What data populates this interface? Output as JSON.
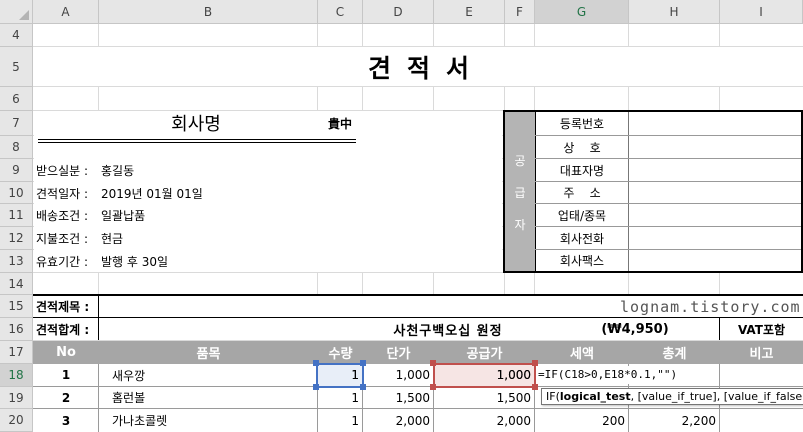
{
  "columns": [
    "A",
    "B",
    "C",
    "D",
    "E",
    "F",
    "G",
    "H",
    "I"
  ],
  "rows": [
    "4",
    "5",
    "6",
    "7",
    "8",
    "9",
    "10",
    "11",
    "12",
    "13",
    "14",
    "15",
    "16",
    "17",
    "18",
    "19",
    "20"
  ],
  "document_title": "견적서",
  "company_label": "회사명",
  "honorific": "貴中",
  "info_rows": [
    {
      "label": "받으실분 :",
      "value": "홍길동"
    },
    {
      "label": "견적일자 :",
      "value": "2019년 01월 01일"
    },
    {
      "label": "배송조건 :",
      "value": "일괄납품"
    },
    {
      "label": "지불조건 :",
      "value": "현금"
    },
    {
      "label": "유효기간 :",
      "value": "발행 후 30일"
    }
  ],
  "supplier": {
    "tag_chars": [
      "공",
      "급",
      "자"
    ],
    "fields": [
      "등록번호",
      "상    호",
      "대표자명",
      "주    소",
      "업태/종목",
      "회사전화",
      "회사팩스"
    ]
  },
  "quote_subject_label": "견적제목 :",
  "quote_total_label": "견적합계 :",
  "quote_total_words": "사천구백오십 원정",
  "quote_total_amount": "(₩4,950)",
  "vat_note": "VAT포함",
  "watermark": "lognam.tistory.com",
  "table_headers": [
    "No",
    "품목",
    "수량",
    "단가",
    "공급가",
    "세액",
    "총계",
    "비고"
  ],
  "table_rows": [
    {
      "no": "1",
      "item": "새우깡",
      "qty": "1",
      "price": "1,000",
      "supply": "1,000",
      "tax": "",
      "total": "",
      "note": ""
    },
    {
      "no": "2",
      "item": "홈런볼",
      "qty": "1",
      "price": "1,500",
      "supply": "1,500",
      "tax": "",
      "total": "",
      "note": ""
    },
    {
      "no": "3",
      "item": "가나초콜렛",
      "qty": "1",
      "price": "2,000",
      "supply": "2,000",
      "tax": "200",
      "total": "2,200",
      "note": ""
    }
  ],
  "editing_formula": "=IF(C18>0,E18*0.1,\"\")",
  "tooltip": {
    "func": "IF(",
    "arg1": "logical_test",
    "rest": ", [value_if_true], [value_if_false])"
  },
  "colors": {
    "header_bg": "#e6e6e6",
    "table_head_bg": "#a6a6a6",
    "selection_blue": "#4472c4",
    "selection_red": "#c0504d",
    "active_green": "#217346"
  }
}
